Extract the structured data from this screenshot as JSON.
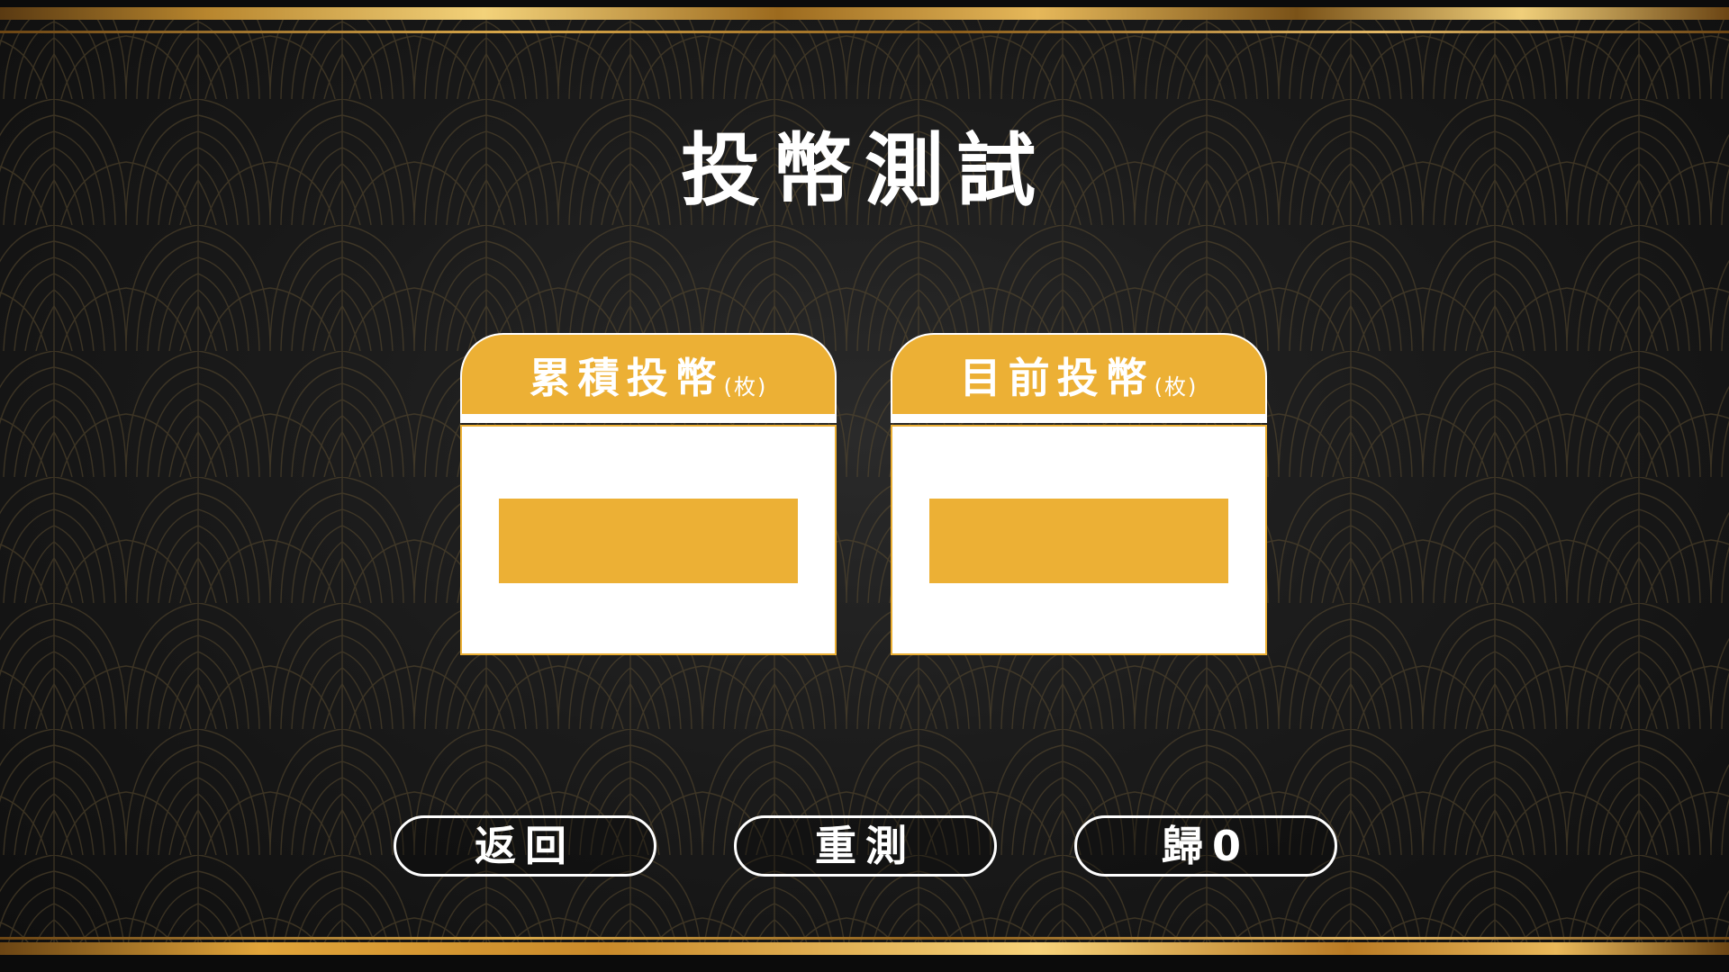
{
  "screen": {
    "title": "投幣測試"
  },
  "panels": [
    {
      "label": "累積投幣",
      "unit": "(枚)",
      "value": ""
    },
    {
      "label": "目前投幣",
      "unit": "(枚)",
      "value": ""
    }
  ],
  "buttons": {
    "back_label": "返回",
    "retest_label": "重測",
    "reset_label": "歸0"
  },
  "colors": {
    "accent_gold": "#ecb035",
    "background": "#1b1b1b",
    "text": "#ffffff"
  }
}
